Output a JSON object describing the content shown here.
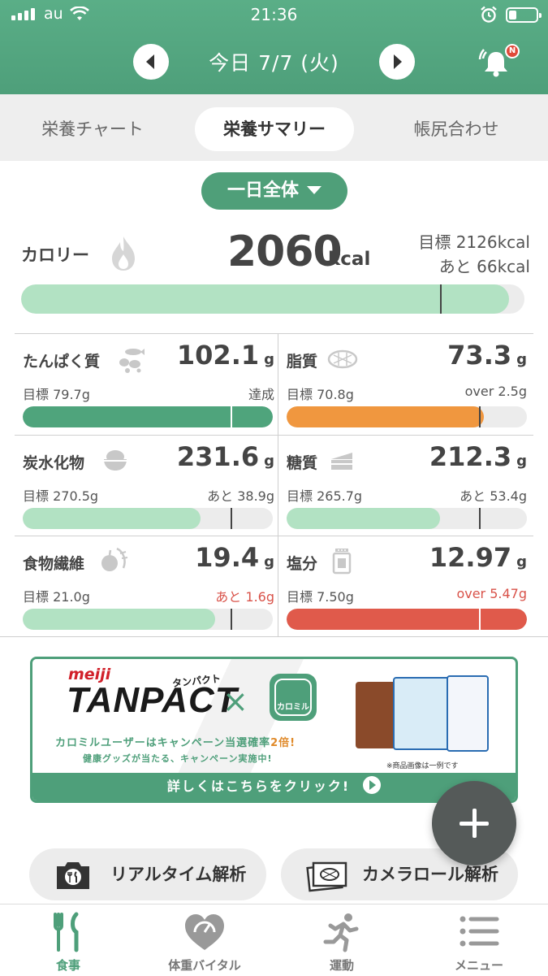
{
  "status_bar": {
    "carrier": "au",
    "time": "21:36"
  },
  "header": {
    "date_title": "今日 7/7 (火)",
    "notification_badge": "N"
  },
  "tabs": [
    {
      "label": "栄養チャート",
      "active": false
    },
    {
      "label": "栄養サマリー",
      "active": true
    },
    {
      "label": "帳尻合わせ",
      "active": false
    }
  ],
  "meal_select": {
    "value": "一日全体"
  },
  "calorie": {
    "label": "カロリー",
    "value": "2060",
    "unit": "kcal",
    "target_text": "目標 2126kcal",
    "remain_text": "あと 66kcal",
    "progress": 0.97,
    "target_mark": 1.0,
    "color": "#b2e2c3"
  },
  "nutrients": [
    {
      "name": "たんぱく質",
      "icon": "protein-icon",
      "value": "102.1",
      "unit": "g",
      "target": "目標 79.7g",
      "status": "達成",
      "status_color": "#555555",
      "progress": 1.0,
      "target_mark": 0.83,
      "color": "#4fa47c"
    },
    {
      "name": "脂質",
      "icon": "fat-icon",
      "value": "73.3",
      "unit": "g",
      "target": "目標 70.8g",
      "status": "over 2.5g",
      "status_color": "#555555",
      "progress": 0.82,
      "target_mark": 0.8,
      "color": "#f0973f"
    },
    {
      "name": "炭水化物",
      "icon": "rice-bowl-icon",
      "value": "231.6",
      "unit": "g",
      "target": "目標 270.5g",
      "status": "あと 38.9g",
      "status_color": "#555555",
      "progress": 0.71,
      "target_mark": 0.83,
      "color": "#b2e2c3"
    },
    {
      "name": "糖質",
      "icon": "cake-icon",
      "value": "212.3",
      "unit": "g",
      "target": "目標 265.7g",
      "status": "あと 53.4g",
      "status_color": "#555555",
      "progress": 0.64,
      "target_mark": 0.8,
      "color": "#b2e2c3"
    },
    {
      "name": "食物繊維",
      "icon": "vegetable-icon",
      "value": "19.4",
      "unit": "g",
      "target": "目標 21.0g",
      "status": "あと 1.6g",
      "status_color": "#d9534a",
      "progress": 0.77,
      "target_mark": 0.83,
      "color": "#b2e2c3"
    },
    {
      "name": "塩分",
      "icon": "salt-shaker-icon",
      "value": "12.97",
      "unit": "g",
      "target": "目標 7.50g",
      "status": "over 5.47g",
      "status_color": "#d9534a",
      "progress": 1.0,
      "target_mark": 0.8,
      "color": "#e05a4b"
    }
  ],
  "banner": {
    "brand": "meiji",
    "logo": "TANPACT",
    "logo_kana": "タンパクト",
    "times": "×",
    "app_name": "カロミル",
    "campaign_main": "カロミルユーザーはキャンペーン当選確率",
    "campaign_em": "2倍!",
    "campaign_sub": "健康グッズが当たる、キャンペーン実施中!",
    "note": "※商品画像は一例です",
    "cta": "詳しくはこちらをクリック!"
  },
  "actions": {
    "realtime": "リアルタイム解析",
    "camera_roll": "カメラロール解析"
  },
  "bottom_nav": [
    {
      "label": "食事",
      "icon": "fork-knife-icon",
      "active": true
    },
    {
      "label": "体重バイタル",
      "icon": "heart-scale-icon",
      "active": false
    },
    {
      "label": "運動",
      "icon": "running-icon",
      "active": false
    },
    {
      "label": "メニュー",
      "icon": "menu-list-icon",
      "active": false
    }
  ],
  "colors": {
    "brand_green": "#4e9f7a",
    "light_green": "#b2e2c3",
    "orange": "#f0973f",
    "red": "#e05a4b"
  }
}
